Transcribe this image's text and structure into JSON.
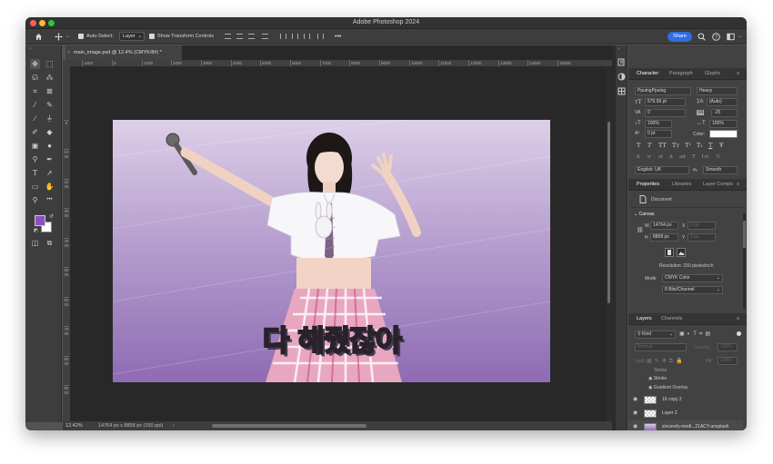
{
  "app": {
    "title": "Adobe Photoshop 2024"
  },
  "options_bar": {
    "auto_select_label": "Auto-Select:",
    "auto_select_value": "Layer",
    "transform_label": "Show Transform Controls",
    "more": "•••",
    "share_label": "Share"
  },
  "document": {
    "tab_title": "main_image.psd @ 12.4% (CMYK/8#) *",
    "artwork_text": "다 해줬잖아"
  },
  "ruler": {
    "top_ticks": [
      "1000",
      "0",
      "1000",
      "2000",
      "3000",
      "4000",
      "5000",
      "6000",
      "7000",
      "8000",
      "9000",
      "10000",
      "11000",
      "12000",
      "13000",
      "14000",
      "15000"
    ],
    "left_ticks": [
      "0",
      "1000",
      "2000",
      "3000",
      "4000",
      "5000",
      "6000",
      "7000",
      "8000",
      "9000"
    ]
  },
  "status": {
    "zoom": "12.42%",
    "info": "14764 px x 8858 px (150 ppi)",
    "arrow": "›"
  },
  "character": {
    "tabs": [
      "Character",
      "Paragraph",
      "Glyphs"
    ],
    "font_family": "PpuingPpuing",
    "font_style": "Heavy",
    "size": "579.56 pt",
    "leading": "(Auto)",
    "kerning": "0",
    "tracking": "-25",
    "vscale": "100%",
    "hscale": "100%",
    "baseline": "0 pt",
    "color_label": "Color:",
    "type_buttons": [
      "T",
      "T",
      "TT",
      "Tт",
      "T¹",
      "T₁",
      "T",
      "Ŧ"
    ],
    "ot_buttons": [
      "fi",
      "σ",
      "st",
      "A",
      "ad",
      "T",
      "1st",
      "½"
    ],
    "language": "English: UK",
    "aa_label": "aₐ",
    "antialias": "Smooth"
  },
  "properties": {
    "tabs": [
      "Properties",
      "Libraries",
      "Layer Comps"
    ],
    "doc_label": "Document",
    "canvas_label": "Canvas",
    "w_label": "W",
    "w_value": "14764 px",
    "x_label": "X",
    "x_value": "0 px",
    "h_label": "H",
    "h_value": "8858 px",
    "y_label": "Y",
    "y_value": "0 px",
    "resolution": "Resolution: 150 pixels/inch",
    "mode_label": "Mode",
    "mode_value": "CMYK Color",
    "depth_value": "8 Bits/Channel"
  },
  "layers": {
    "tabs": [
      "Layers",
      "Channels"
    ],
    "kind": "Kind",
    "blend": "Normal",
    "opacity_label": "Opacity:",
    "opacity": "100%",
    "lock_label": "Lock:",
    "fill_label": "Fill:",
    "fill": "100%",
    "effects": [
      "Stroke",
      "Stroke",
      "Gradient Overlay"
    ],
    "items": [
      "16 copy 2",
      "Layer 2",
      "sincerely-medi...21ACY-unsplash"
    ]
  },
  "colors": {
    "foreground": "#8e4fc0",
    "background": "#ffffff",
    "accent": "#2f6de1"
  }
}
